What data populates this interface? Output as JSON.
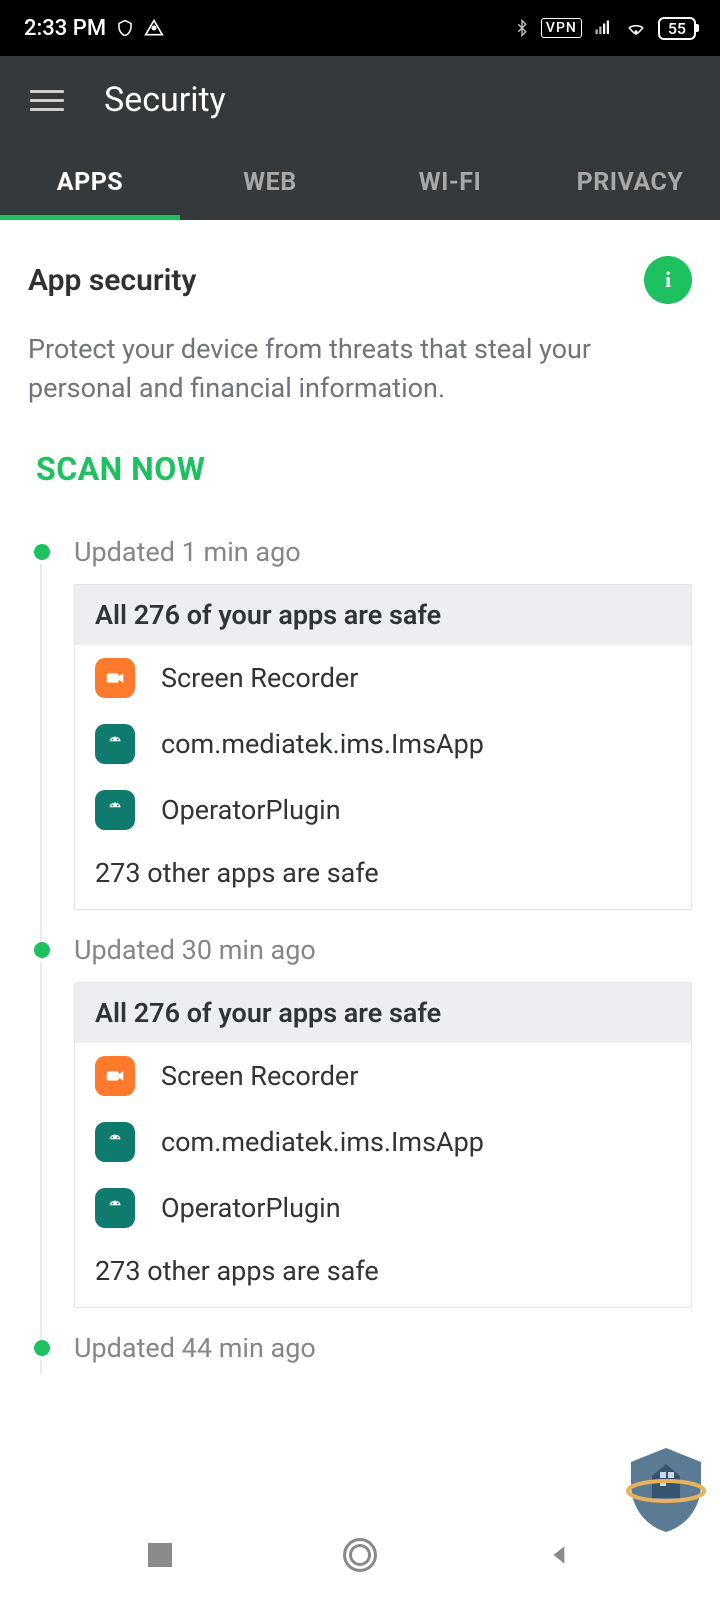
{
  "status": {
    "time": "2:33 PM",
    "vpn_label": "VPN",
    "battery": "55"
  },
  "header": {
    "title": "Security"
  },
  "tabs": [
    {
      "label": "APPS",
      "active": true
    },
    {
      "label": "WEB",
      "active": false
    },
    {
      "label": "WI-FI",
      "active": false
    },
    {
      "label": "PRIVACY",
      "active": false
    }
  ],
  "section": {
    "title": "App security",
    "description": "Protect your device from threats that steal your personal and financial information.",
    "scan_label": "SCAN NOW",
    "info_symbol": "i"
  },
  "updates": [
    {
      "time_label": "Updated 1 min ago",
      "card_title": "All 276 of your apps are safe",
      "apps": [
        {
          "name": "Screen Recorder",
          "icon": "camera"
        },
        {
          "name": "com.mediatek.ims.ImsApp",
          "icon": "android"
        },
        {
          "name": "OperatorPlugin",
          "icon": "android"
        }
      ],
      "summary": "273 other apps are safe"
    },
    {
      "time_label": "Updated 30 min ago",
      "card_title": "All 276 of your apps are safe",
      "apps": [
        {
          "name": "Screen Recorder",
          "icon": "camera"
        },
        {
          "name": "com.mediatek.ims.ImsApp",
          "icon": "android"
        },
        {
          "name": "OperatorPlugin",
          "icon": "android"
        }
      ],
      "summary": "273 other apps are safe"
    },
    {
      "time_label": "Updated 44 min ago",
      "card_title": "",
      "apps": [],
      "summary": ""
    }
  ]
}
